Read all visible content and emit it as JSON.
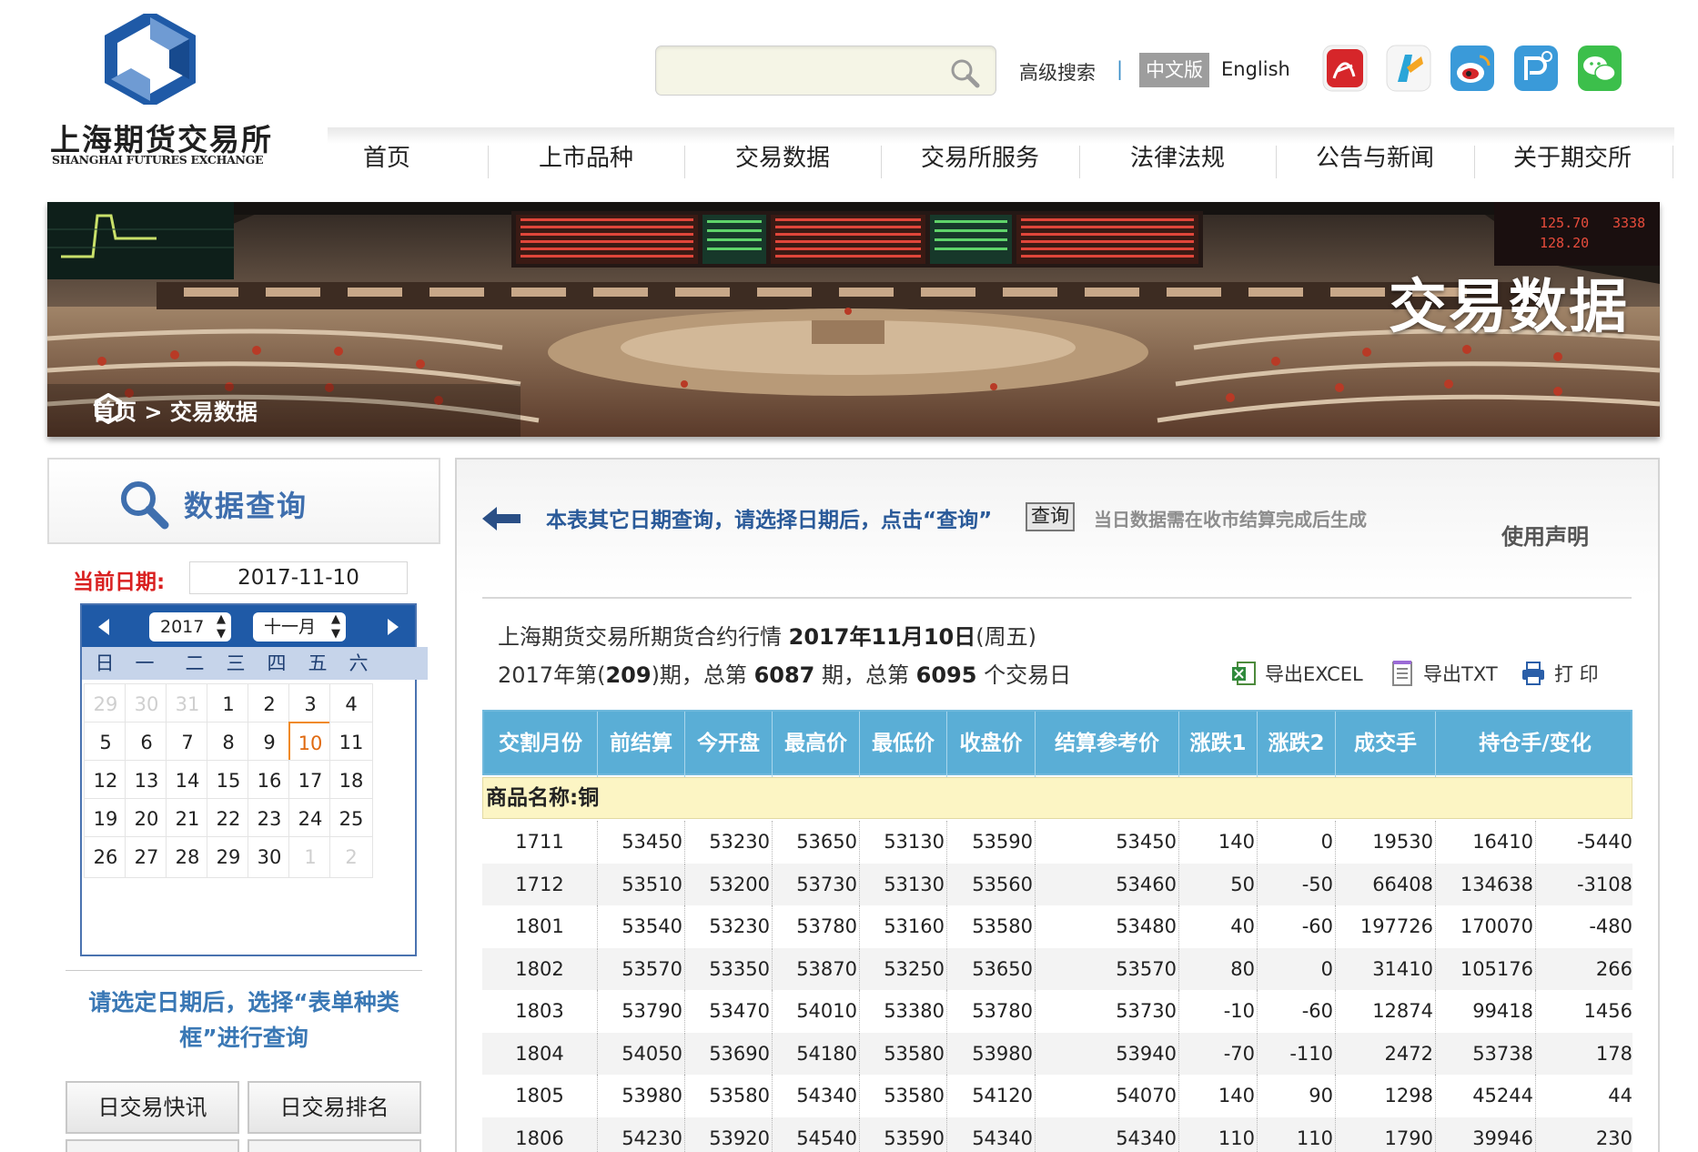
{
  "brand": {
    "name_cn": "上海期货交易所",
    "name_en": "SHANGHAI FUTURES EXCHANGE",
    "color": "#1f5aa7"
  },
  "header": {
    "search_placeholder": "",
    "advanced_search": "高级搜索",
    "separator": "|",
    "lang_cn": "中文版",
    "lang_en": "English",
    "social": [
      "pdf-reader-icon",
      "kugou-icon",
      "weibo-icon",
      "mobile-app-icon",
      "wechat-icon"
    ]
  },
  "nav": {
    "items": [
      "首页",
      "上市品种",
      "交易数据",
      "交易所服务",
      "法律法规",
      "公告与新闻",
      "关于期交所"
    ]
  },
  "banner": {
    "title": "交易数据",
    "breadcrumb": "首页 > 交易数据"
  },
  "sidebar": {
    "title": "数据查询",
    "current_date_label": "当前日期:",
    "current_date": "2017-11-10",
    "calendar": {
      "year": "2017",
      "month": "十一月",
      "weekdays": [
        "日",
        "一",
        "二",
        "三",
        "四",
        "五",
        "六"
      ],
      "rows": [
        [
          "29",
          "30",
          "31",
          "1",
          "2",
          "3",
          "4"
        ],
        [
          "5",
          "6",
          "7",
          "8",
          "9",
          "10",
          "11"
        ],
        [
          "12",
          "13",
          "14",
          "15",
          "16",
          "17",
          "18"
        ],
        [
          "19",
          "20",
          "21",
          "22",
          "23",
          "24",
          "25"
        ],
        [
          "26",
          "27",
          "28",
          "29",
          "30",
          "1",
          "2"
        ]
      ]
    },
    "hint": "请选定日期后，选择“表单种类框”进行查询",
    "buttons": [
      "日交易快讯",
      "日交易排名"
    ]
  },
  "main": {
    "query_text": "本表其它日期查询，请选择日期后，点击“查询”",
    "query_button": "查询",
    "note": "当日数据需在收市结算完成后生成",
    "usage": "使用声明",
    "title_prefix": "上海期货交易所期货合约行情",
    "title_date": "2017年11月10日",
    "title_weekday": "(周五)",
    "period_line_a": "2017年第(",
    "period_num": "209",
    "period_line_b": ")期，总第",
    "total_periods": "6087",
    "period_line_c": "期，总第",
    "total_days": "6095",
    "period_line_d": "个交易日",
    "export_excel": "导出EXCEL",
    "export_txt": "导出TXT",
    "print": "打 印"
  },
  "table": {
    "headers": [
      "交割月份",
      "前结算",
      "今开盘",
      "最高价",
      "最低价",
      "收盘价",
      "结算参考价",
      "涨跌1",
      "涨跌2",
      "成交手",
      "持仓手/变化"
    ],
    "product_label": "商品名称:铜",
    "rows": [
      [
        "1711",
        "53450",
        "53230",
        "53650",
        "53130",
        "53590",
        "53450",
        "140",
        "0",
        "19530",
        "16410",
        "-5440"
      ],
      [
        "1712",
        "53510",
        "53200",
        "53730",
        "53130",
        "53560",
        "53460",
        "50",
        "-50",
        "66408",
        "134638",
        "-3108"
      ],
      [
        "1801",
        "53540",
        "53230",
        "53780",
        "53160",
        "53580",
        "53480",
        "40",
        "-60",
        "197726",
        "170070",
        "-480"
      ],
      [
        "1802",
        "53570",
        "53350",
        "53870",
        "53250",
        "53650",
        "53570",
        "80",
        "0",
        "31410",
        "105176",
        "266"
      ],
      [
        "1803",
        "53790",
        "53470",
        "54010",
        "53380",
        "53780",
        "53730",
        "-10",
        "-60",
        "12874",
        "99418",
        "1456"
      ],
      [
        "1804",
        "54050",
        "53690",
        "54180",
        "53580",
        "53980",
        "53940",
        "-70",
        "-110",
        "2472",
        "53738",
        "178"
      ],
      [
        "1805",
        "53980",
        "53580",
        "54340",
        "53580",
        "54120",
        "54070",
        "140",
        "90",
        "1298",
        "45244",
        "44"
      ],
      [
        "1806",
        "54230",
        "53920",
        "54540",
        "53590",
        "54340",
        "54340",
        "110",
        "110",
        "1790",
        "39946",
        "230"
      ]
    ]
  }
}
